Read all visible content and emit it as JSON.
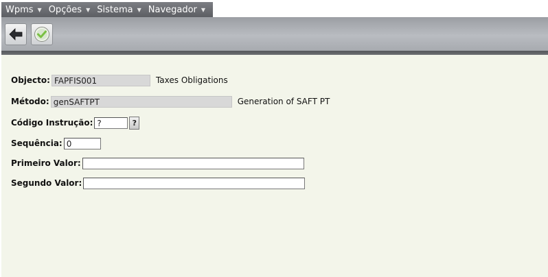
{
  "menu": [
    {
      "label": "Wpms"
    },
    {
      "label": "Opções"
    },
    {
      "label": "Sistema"
    },
    {
      "label": "Navegador"
    }
  ],
  "toolbar": {
    "back_icon": "arrow-left-icon",
    "confirm_icon": "check-circle-icon",
    "accent": "#7ac043"
  },
  "form": {
    "objecto": {
      "label": "Objecto:",
      "value": "FAPFIS001",
      "description": "Taxes Obligations"
    },
    "metodo": {
      "label": "Método:",
      "value": "genSAFTPT",
      "description": "Generation of SAFT PT"
    },
    "codigo": {
      "label": "Código Instrução:",
      "value": "?",
      "button": "?"
    },
    "sequencia": {
      "label": "Sequência:",
      "value": "0"
    },
    "primeiro": {
      "label": "Primeiro Valor:",
      "value": ""
    },
    "segundo": {
      "label": "Segundo Valor:",
      "value": ""
    }
  },
  "colors": {
    "background": "#f3f5ea",
    "menubar": "#5c5e63",
    "readonly_field": "#d8d8d8"
  }
}
